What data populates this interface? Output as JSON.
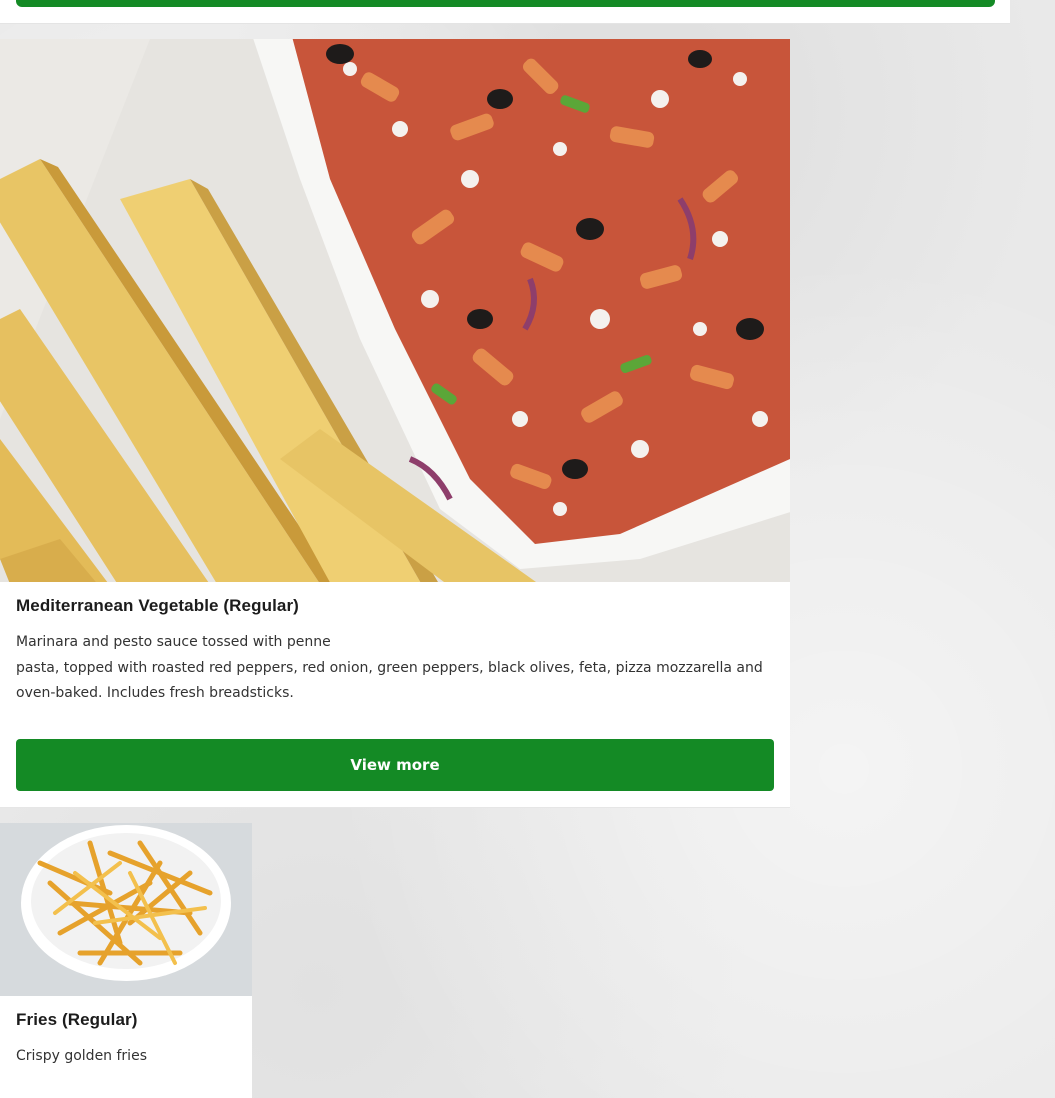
{
  "menu_items": [
    {
      "name": "Mediterranean Vegetable (Regular)",
      "description_line1": "Marinara and pesto sauce tossed with penne",
      "description_rest": "pasta, topped with roasted red peppers, red onion, green peppers, black olives, feta, pizza mozzarella and oven-baked. Includes fresh breadsticks.",
      "button_label": "View more",
      "image_icon": "pasta-dish-image"
    },
    {
      "name": "Fries (Regular)",
      "description": "Crispy golden fries",
      "image_icon": "fries-bowl-image"
    }
  ],
  "colors": {
    "accent_green": "#148a25",
    "card_background": "#ffffff",
    "page_background": "#e9e9e9"
  }
}
